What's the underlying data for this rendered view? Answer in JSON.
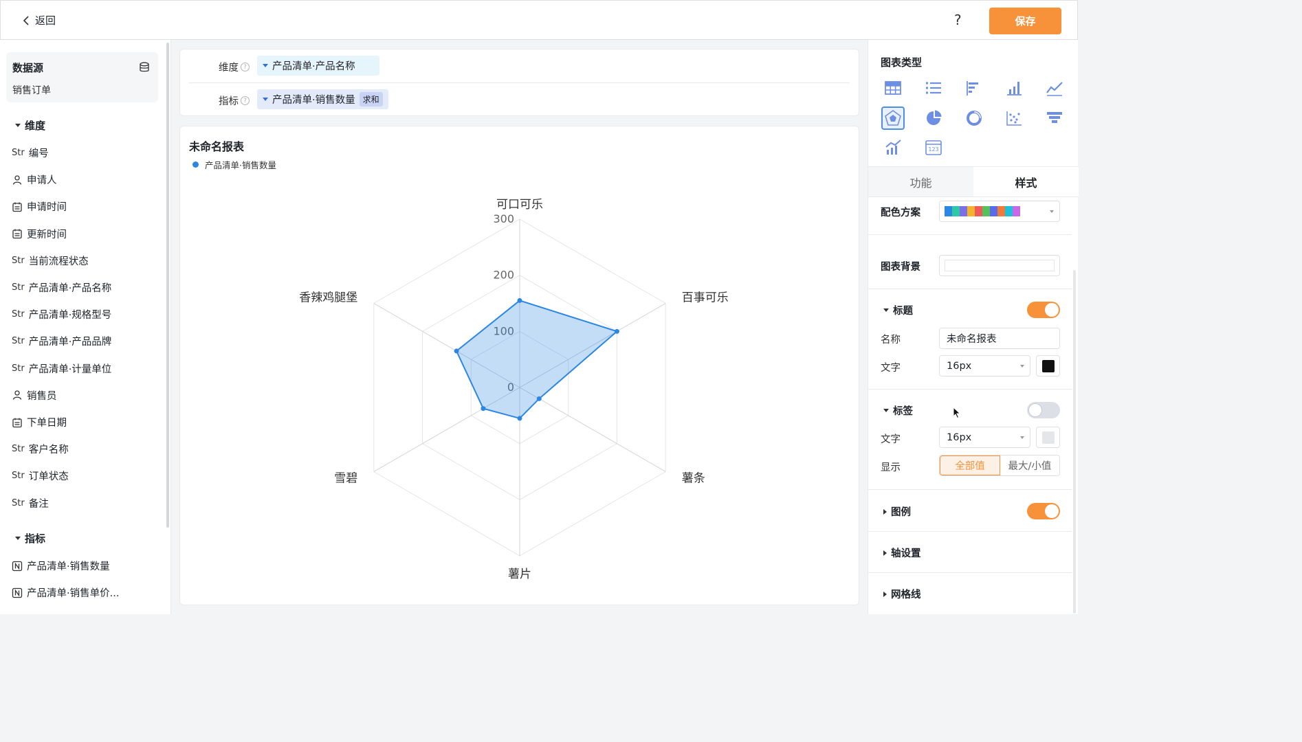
{
  "header": {
    "back_label": "返回",
    "help_label": "?",
    "save_label": "保存"
  },
  "left": {
    "datasource_title": "数据源",
    "datasource_name": "销售订单",
    "dimension_section": "维度",
    "dimensions": [
      {
        "type": "Str",
        "label": "编号"
      },
      {
        "type": "user-icon",
        "label": "申请人"
      },
      {
        "type": "calendar-icon",
        "label": "申请时间"
      },
      {
        "type": "calendar-icon",
        "label": "更新时间"
      },
      {
        "type": "Str",
        "label": "当前流程状态"
      },
      {
        "type": "Str",
        "label": "产品清单·产品名称"
      },
      {
        "type": "Str",
        "label": "产品清单·规格型号"
      },
      {
        "type": "Str",
        "label": "产品清单·产品品牌"
      },
      {
        "type": "Str",
        "label": "产品清单·计量单位"
      },
      {
        "type": "user-icon",
        "label": "销售员"
      },
      {
        "type": "calendar-icon",
        "label": "下单日期"
      },
      {
        "type": "Str",
        "label": "客户名称"
      },
      {
        "type": "Str",
        "label": "订单状态"
      },
      {
        "type": "Str",
        "label": "备注"
      }
    ],
    "metric_section": "指标",
    "metrics": [
      {
        "type": "number-icon",
        "label": "产品清单·销售数量"
      },
      {
        "type": "number-icon",
        "label": "产品清单·销售单价..."
      }
    ]
  },
  "config": {
    "dimension_label": "维度",
    "dimension_value": "产品清单·产品名称",
    "metric_label": "指标",
    "metric_value": "产品清单·销售数量",
    "metric_agg": "求和"
  },
  "chart_data": {
    "type": "radar",
    "title": "未命名报表",
    "categories": [
      "可口可乐",
      "百事可乐",
      "薯条",
      "薯片",
      "雪碧",
      "香辣鸡腿堡"
    ],
    "series": [
      {
        "name": "产品清单·销售数量",
        "values": [
          155,
          200,
          40,
          55,
          75,
          130
        ],
        "color": "#2b86e4"
      }
    ],
    "radial_ticks": [
      0,
      100,
      200,
      300
    ],
    "rmax": 300,
    "legend_position": "top-left"
  },
  "right": {
    "chart_type_title": "图表类型",
    "chart_types": [
      "table-icon",
      "list-icon",
      "bar-horizontal-icon",
      "bar-chart-icon",
      "line-chart-icon",
      "radar-icon",
      "pie-icon",
      "donut-icon",
      "scatter-icon",
      "funnel-icon",
      "combo-chart-icon",
      "number-card-icon"
    ],
    "active_chart_type": "radar-icon",
    "tabs": [
      "功能",
      "样式"
    ],
    "active_tab": "样式",
    "color_scheme_label": "配色方案",
    "color_scheme": [
      "#2b86e4",
      "#2dc8a4",
      "#7b6fe8",
      "#f5b22d",
      "#ef5a5a",
      "#56c15a",
      "#5a6be8",
      "#f07a3a",
      "#1ec0d8",
      "#c867e8"
    ],
    "chart_bg_label": "图表背景",
    "title_section": {
      "label": "标题",
      "enabled": true,
      "name_label": "名称",
      "name_value": "未命名报表",
      "text_label": "文字",
      "font_size": "16px",
      "color": "#111111"
    },
    "label_section": {
      "label": "标签",
      "enabled": false,
      "text_label": "文字",
      "font_size": "16px",
      "color": "#e4e6ea",
      "display_label": "显示",
      "options": [
        "全部值",
        "最大/小值"
      ],
      "selected": "全部值"
    },
    "legend_section": {
      "label": "图例",
      "enabled": true
    },
    "axis_section": {
      "label": "轴设置"
    },
    "grid_section": {
      "label": "网格线"
    }
  }
}
